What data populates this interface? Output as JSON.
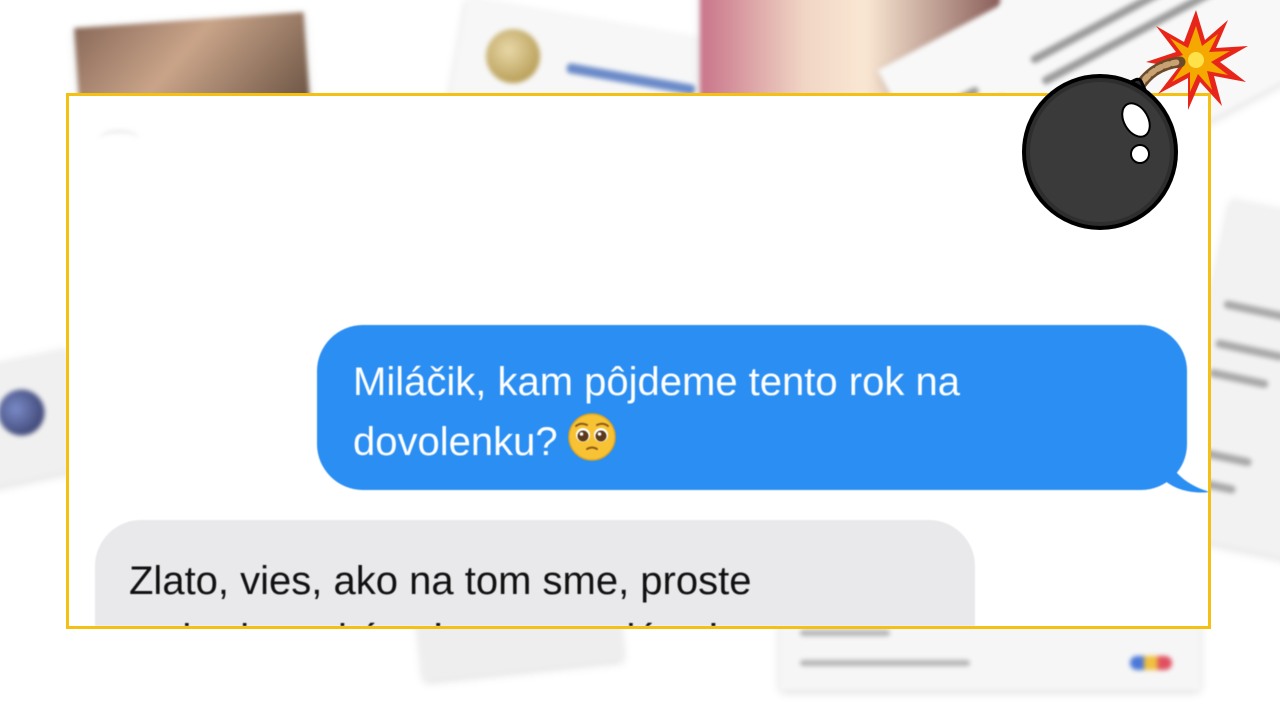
{
  "messages": [
    {
      "direction": "sent",
      "lines": [
        "Miláčik, kam pôjdeme tento rok na",
        "dovolenku?"
      ],
      "emoji": "pleading-face",
      "bubble_color": "#2a8ef2",
      "text_color": "#ffffff"
    },
    {
      "direction": "received",
      "lines": [
        "Zlato, vies, ako na tom sme, proste",
        "sa budeme kúpať v poto a plávať v"
      ],
      "bubble_color": "#e9e9ec",
      "text_color": "#111111"
    }
  ],
  "frame": {
    "border_color": "#f5c014"
  },
  "overlay": {
    "icon": "bomb-icon",
    "spark_colors": [
      "#f5a800",
      "#e8251a"
    ]
  }
}
